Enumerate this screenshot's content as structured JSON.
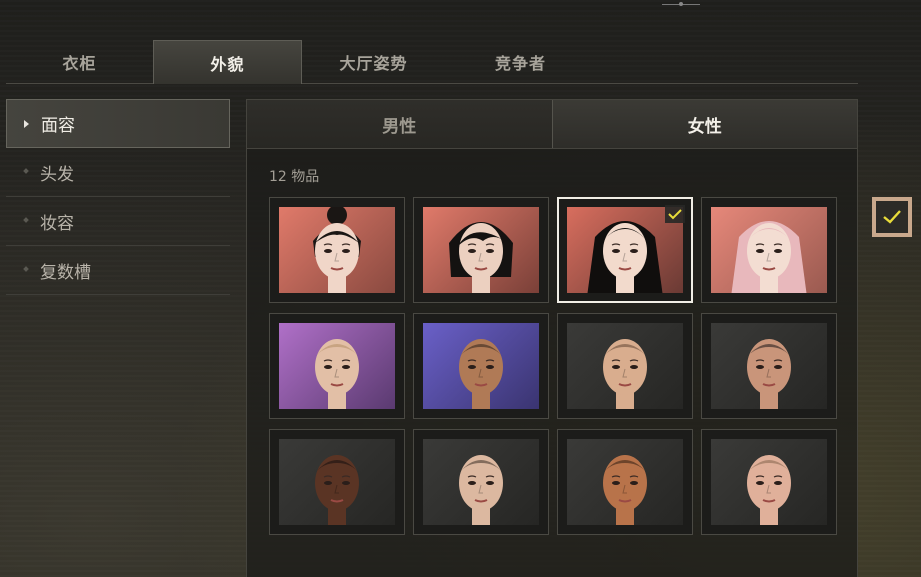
{
  "tabs": [
    {
      "label": "衣柜",
      "active": false
    },
    {
      "label": "外貌",
      "active": true
    },
    {
      "label": "大厅姿势",
      "active": false
    },
    {
      "label": "竞争者",
      "active": false
    }
  ],
  "side_menu": [
    {
      "label": "面容",
      "active": true
    },
    {
      "label": "头发",
      "active": false
    },
    {
      "label": "妆容",
      "active": false
    },
    {
      "label": "复数槽",
      "active": false
    }
  ],
  "gender_tabs": [
    {
      "label": "男性",
      "active": false
    },
    {
      "label": "女性",
      "active": true
    }
  ],
  "item_count": "12 物品",
  "colors": {
    "check_yellow": "#e8dc3a",
    "accent_border": "#c9a88c"
  },
  "faces": [
    {
      "id": 1,
      "bg": [
        "#e07a6a",
        "#8a4a40"
      ],
      "skin": "#f0d6c8",
      "hair": "#1a1614",
      "hair_style": "bun",
      "selected": false
    },
    {
      "id": 2,
      "bg": [
        "#e07a6a",
        "#7a4038"
      ],
      "skin": "#ecd0c0",
      "hair": "#141211",
      "hair_style": "bob",
      "selected": false
    },
    {
      "id": 3,
      "bg": [
        "#d86e5e",
        "#6a3a34"
      ],
      "skin": "#f2dacc",
      "hair": "#100e0d",
      "hair_style": "long",
      "selected": true
    },
    {
      "id": 4,
      "bg": [
        "#e6887a",
        "#9a5a50"
      ],
      "skin": "#f3ddd2",
      "hair": "#e8b8bc",
      "hair_style": "long",
      "selected": false
    },
    {
      "id": 5,
      "bg": [
        "#b070c8",
        "#5a3a70"
      ],
      "skin": "#e2bfa6",
      "hair": "#b8926a",
      "hair_style": "shaved",
      "selected": false
    },
    {
      "id": 6,
      "bg": [
        "#6a60c8",
        "#3a3470"
      ],
      "skin": "#b07a56",
      "hair": "#3a2a20",
      "hair_style": "shaved",
      "selected": false
    },
    {
      "id": 7,
      "bg": [
        "#3a3a38",
        "#262624"
      ],
      "skin": "#d9ad8e",
      "hair": "#6a4e3a",
      "hair_style": "shaved",
      "selected": false
    },
    {
      "id": 8,
      "bg": [
        "#3a3a38",
        "#262624"
      ],
      "skin": "#c9957a",
      "hair": "#2a2220",
      "hair_style": "shaved",
      "selected": false
    },
    {
      "id": 9,
      "bg": [
        "#3a3a38",
        "#262624"
      ],
      "skin": "#5a3424",
      "hair": "#1a1210",
      "hair_style": "shaved",
      "selected": false
    },
    {
      "id": 10,
      "bg": [
        "#3a3a38",
        "#262624"
      ],
      "skin": "#dcb8a0",
      "hair": "#4a3a30",
      "hair_style": "shaved",
      "selected": false
    },
    {
      "id": 11,
      "bg": [
        "#3a3a38",
        "#262624"
      ],
      "skin": "#b8734a",
      "hair": "#3a2418",
      "hair_style": "shaved",
      "selected": false
    },
    {
      "id": 12,
      "bg": [
        "#3a3a38",
        "#262624"
      ],
      "skin": "#e0b09a",
      "hair": "#8a6a54",
      "hair_style": "shaved",
      "selected": false
    }
  ]
}
